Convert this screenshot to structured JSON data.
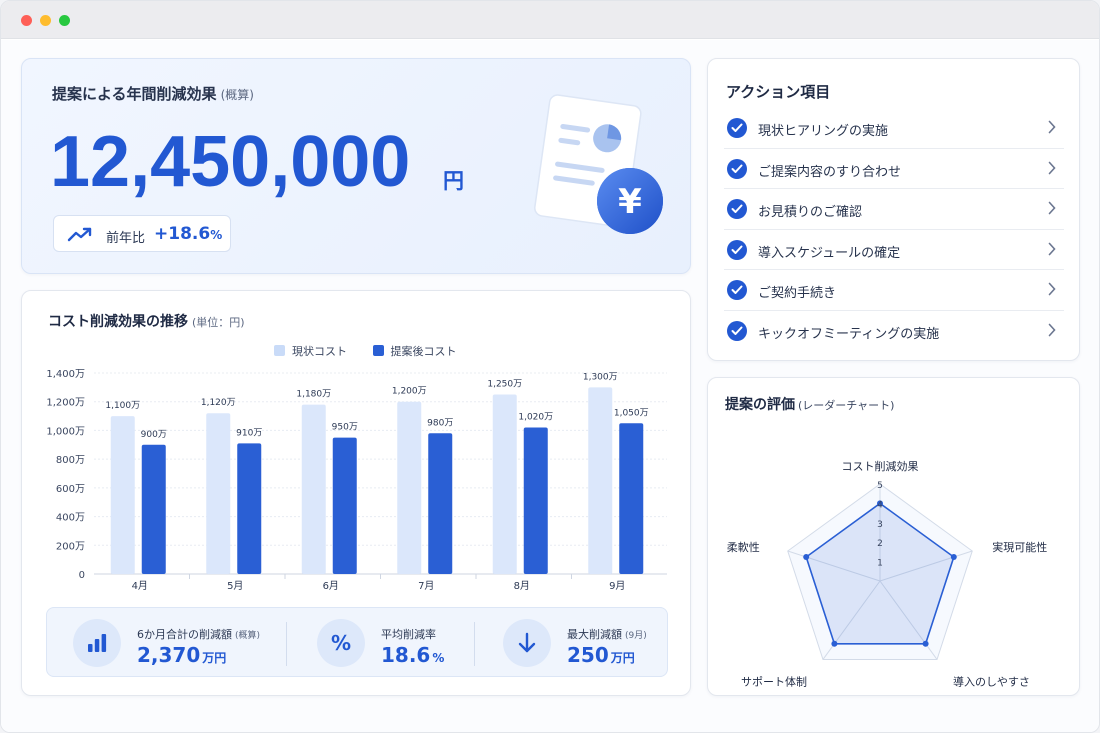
{
  "hero": {
    "title": "提案による年間削減効果",
    "title_note": "(概算)",
    "amount": "12,450,000",
    "unit": "円",
    "yoy_label": "前年比",
    "yoy_value": "+18.6",
    "yoy_unit": "%"
  },
  "actions": {
    "title": "アクション項目",
    "items": [
      {
        "label": "現状ヒアリングの実施"
      },
      {
        "label": "ご提案内容のすり合わせ"
      },
      {
        "label": "お見積りのご確認"
      },
      {
        "label": "導入スケジュールの確定"
      },
      {
        "label": "ご契約手続き"
      },
      {
        "label": "キックオフミーティングの実施"
      }
    ]
  },
  "chart_card": {
    "title": "コスト削減効果の推移",
    "title_note": "(単位：円)"
  },
  "chart_data": [
    {
      "type": "bar",
      "categories": [
        "4月",
        "5月",
        "6月",
        "7月",
        "8月",
        "9月"
      ],
      "series": [
        {
          "name": "現状コスト",
          "values": [
            1100,
            1120,
            1180,
            1200,
            1250,
            1300
          ],
          "labels": [
            "1,100万",
            "1,120万",
            "1,180万",
            "1,200万",
            "1,250万",
            "1,300万"
          ],
          "color": "#dbe7fb"
        },
        {
          "name": "提案後コスト",
          "values": [
            900,
            910,
            950,
            980,
            1020,
            1050
          ],
          "labels": [
            "900万",
            "910万",
            "950万",
            "980万",
            "1,020万",
            "1,050万"
          ],
          "color": "#2a5fd4"
        }
      ],
      "yticks": [
        "0",
        "200万",
        "400万",
        "600万",
        "800万",
        "1,000万",
        "1,200万",
        "1,400万"
      ],
      "ylim": [
        0,
        1400
      ],
      "grid": true,
      "legend": "top-center"
    },
    {
      "type": "radar",
      "title": "提案の評価",
      "subtitle": "(レーダーチャート)",
      "axes": [
        "コスト削減効果",
        "実現可能性",
        "導入のしやすさ",
        "サポート体制",
        "柔軟性"
      ],
      "values": [
        4,
        4,
        4,
        4,
        4
      ],
      "scale_ticks": [
        "1",
        "2",
        "3",
        "4",
        "5"
      ],
      "max": 5,
      "color": "#2a5fd4"
    }
  ],
  "stats": [
    {
      "label": "6か月合計の削減額",
      "note": "(概算)",
      "value": "2,370",
      "unit": "万円",
      "icon": "bar-chart-icon"
    },
    {
      "label": "平均削減率",
      "note": "",
      "value": "18.6",
      "unit": "%",
      "icon": "percent-icon"
    },
    {
      "label": "最大削減額",
      "note": "(9月)",
      "value": "250",
      "unit": "万円",
      "icon": "arrow-down-icon"
    }
  ],
  "colors": {
    "accent": "#2258d2",
    "light_bar": "#dbe7fb"
  }
}
